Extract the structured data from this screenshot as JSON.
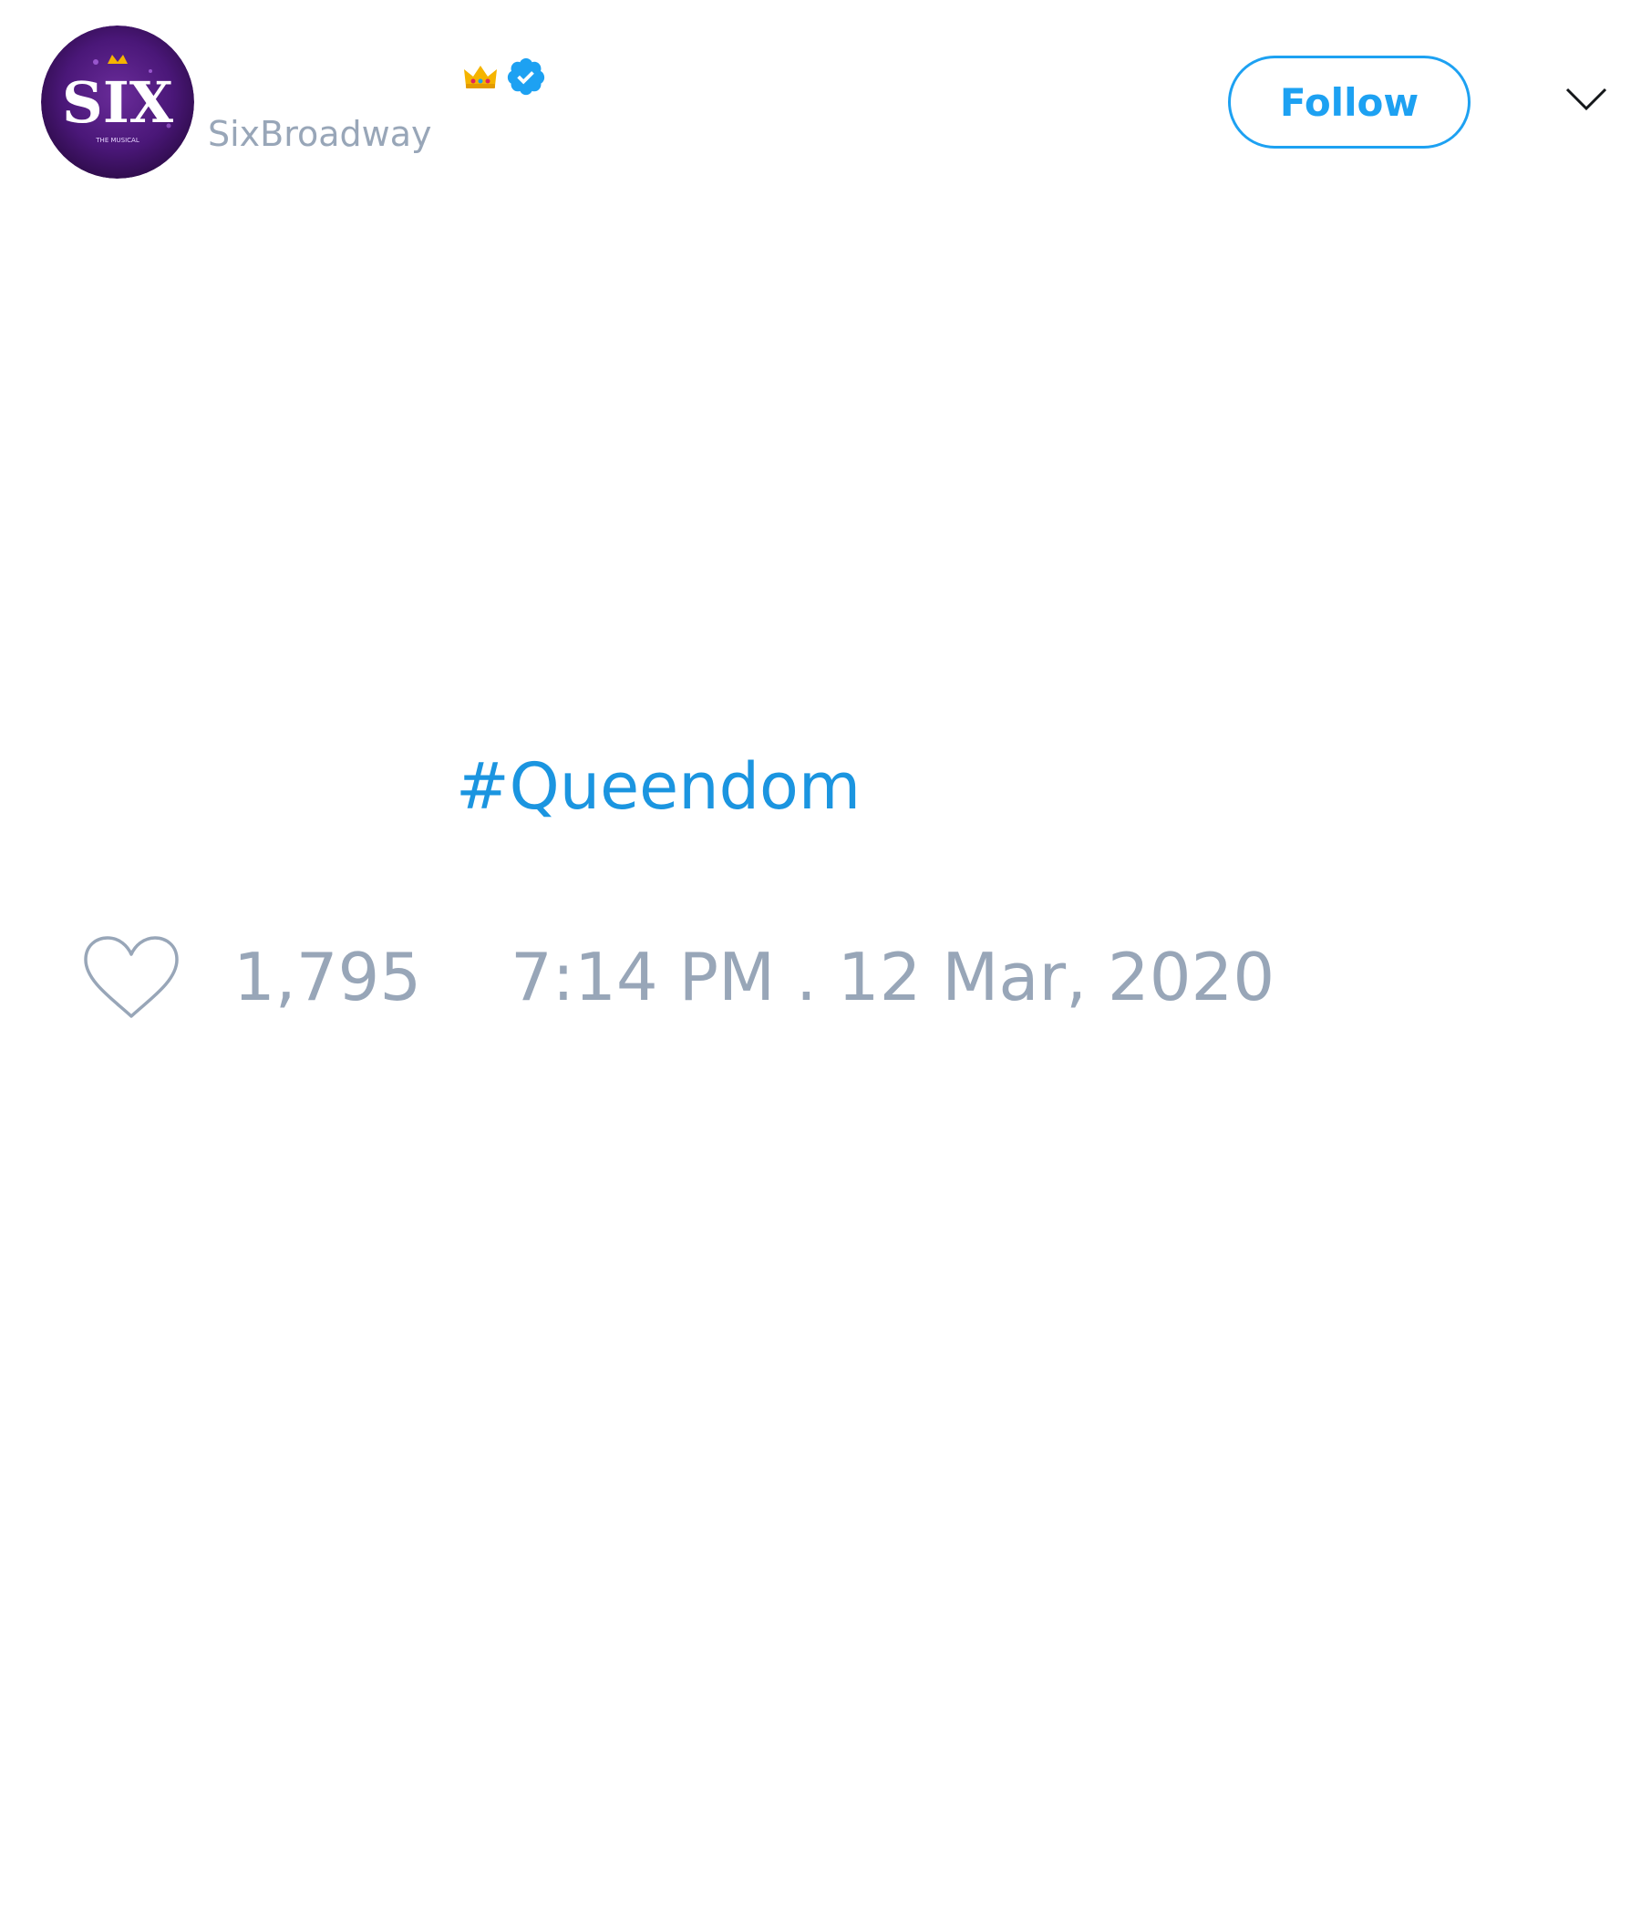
{
  "tweet": {
    "author": {
      "display_name": "",
      "handle": "SixBroadway",
      "avatar_logo_text": "SIX",
      "avatar_subtext": "THE MUSICAL",
      "crown_emoji": "👑",
      "verified": true
    },
    "follow_label": "Follow",
    "hashtag": "#Queendom",
    "like_count": "1,795",
    "timestamp": "7:14 PM . 12 Mar, 2020"
  },
  "colors": {
    "accent": "#1da1f2",
    "hashtag": "#1b95e0",
    "muted": "#98a6b8",
    "avatar_bg": "#3b0f5e",
    "crown": "#f5b400"
  },
  "icons": {
    "verified": "verified-badge-icon",
    "crown": "crown-emoji-icon",
    "menu": "chevron-down-icon",
    "like": "heart-icon"
  }
}
